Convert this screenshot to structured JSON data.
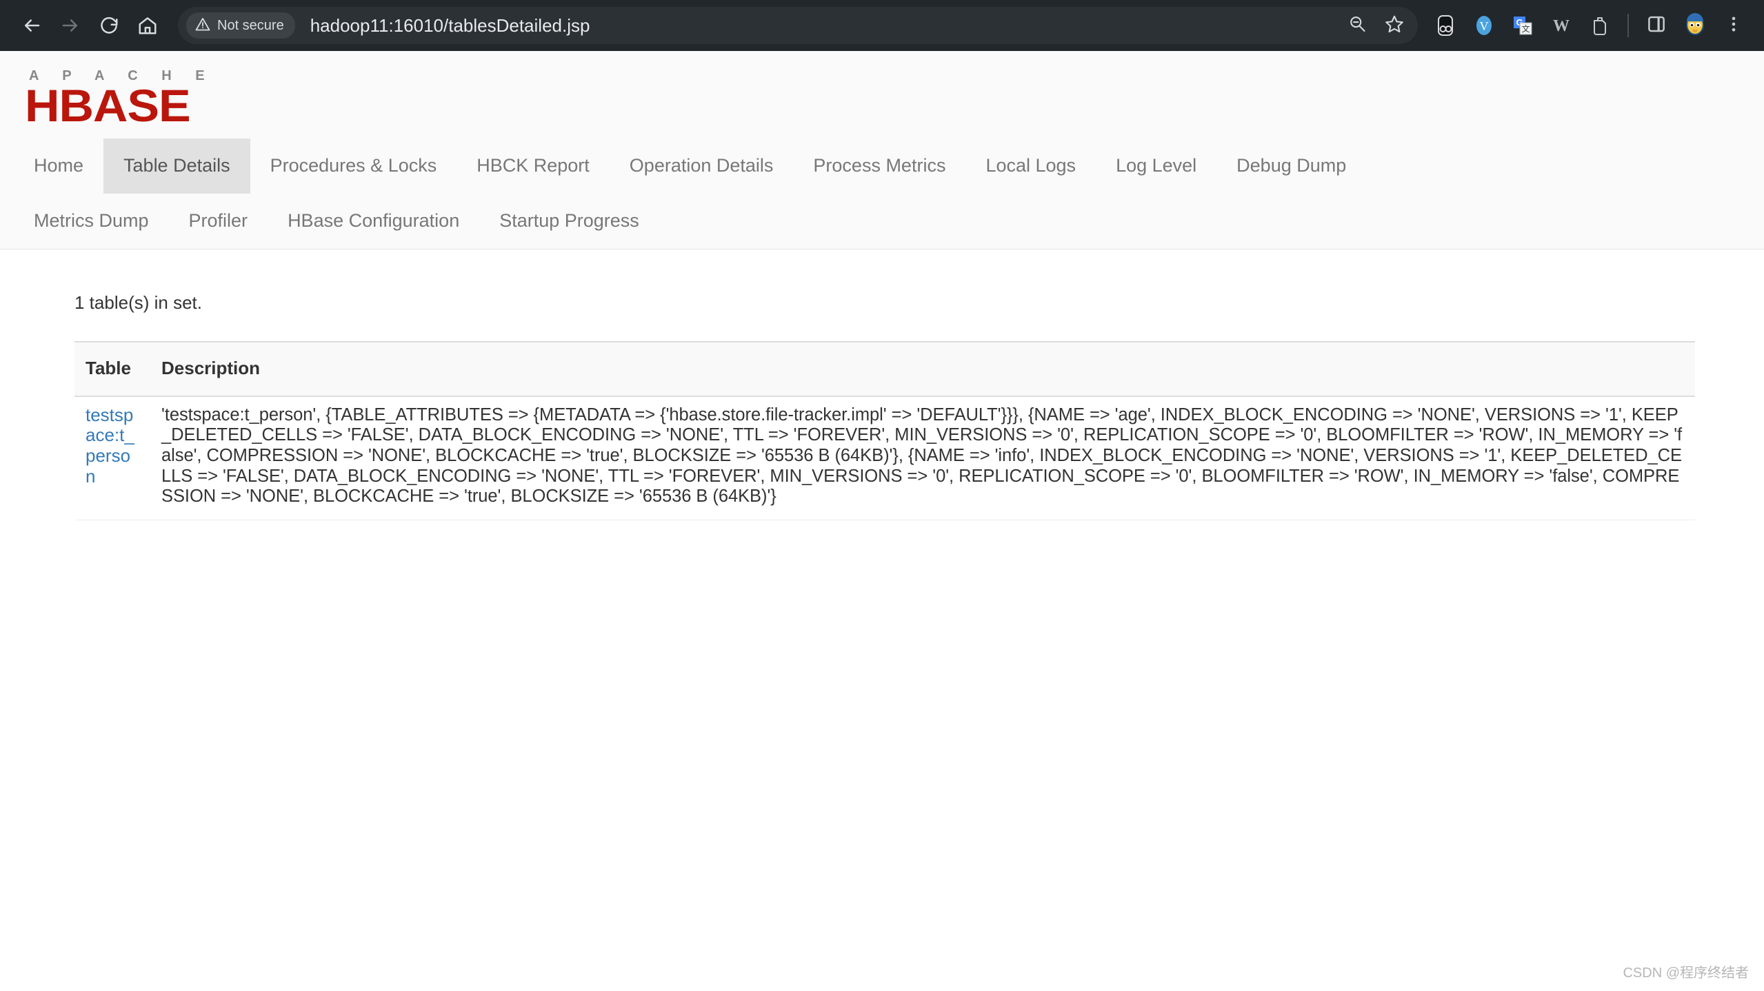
{
  "browser": {
    "back_icon": "back-arrow-icon",
    "forward_icon": "forward-arrow-icon",
    "reload_icon": "reload-icon",
    "home_icon": "home-icon",
    "security_label": "Not secure",
    "url": "hadoop11:16010/tablesDetailed.jsp",
    "zoom_out_icon": "zoom-out-icon",
    "bookmark_icon": "star-icon",
    "extensions": [
      {
        "name": "extension-icon-onetab"
      },
      {
        "name": "extension-icon-vimium"
      },
      {
        "name": "extension-icon-google-translate"
      },
      {
        "name": "extension-icon-w"
      },
      {
        "name": "extension-icon-clipboard"
      }
    ],
    "side_panel_icon": "side-panel-icon",
    "profile_icon": "profile-avatar-icon",
    "menu_icon": "three-dot-menu-icon"
  },
  "logo": {
    "apache": "A P A C H E",
    "hbase": "HBASE"
  },
  "nav": {
    "rows": [
      [
        {
          "label": "Home",
          "active": false
        },
        {
          "label": "Table Details",
          "active": true
        },
        {
          "label": "Procedures & Locks",
          "active": false
        },
        {
          "label": "HBCK Report",
          "active": false
        },
        {
          "label": "Operation Details",
          "active": false
        },
        {
          "label": "Process Metrics",
          "active": false
        },
        {
          "label": "Local Logs",
          "active": false
        },
        {
          "label": "Log Level",
          "active": false
        },
        {
          "label": "Debug Dump",
          "active": false
        }
      ],
      [
        {
          "label": "Metrics Dump",
          "active": false
        },
        {
          "label": "Profiler",
          "active": false
        },
        {
          "label": "HBase Configuration",
          "active": false
        },
        {
          "label": "Startup Progress",
          "active": false
        }
      ]
    ]
  },
  "content": {
    "table_count_text": "1 table(s) in set.",
    "columns": [
      "Table",
      "Description"
    ],
    "rows": [
      {
        "table": "testspace:t_person",
        "description": "'testspace:t_person', {TABLE_ATTRIBUTES => {METADATA => {'hbase.store.file-tracker.impl' => 'DEFAULT'}}}, {NAME => 'age', INDEX_BLOCK_ENCODING => 'NONE', VERSIONS => '1', KEEP_DELETED_CELLS => 'FALSE', DATA_BLOCK_ENCODING => 'NONE', TTL => 'FOREVER', MIN_VERSIONS => '0', REPLICATION_SCOPE => '0', BLOOMFILTER => 'ROW', IN_MEMORY => 'false', COMPRESSION => 'NONE', BLOCKCACHE => 'true', BLOCKSIZE => '65536 B (64KB)'}, {NAME => 'info', INDEX_BLOCK_ENCODING => 'NONE', VERSIONS => '1', KEEP_DELETED_CELLS => 'FALSE', DATA_BLOCK_ENCODING => 'NONE', TTL => 'FOREVER', MIN_VERSIONS => '0', REPLICATION_SCOPE => '0', BLOOMFILTER => 'ROW', IN_MEMORY => 'false', COMPRESSION => 'NONE', BLOCKCACHE => 'true', BLOCKSIZE => '65536 B (64KB)'}"
      }
    ]
  },
  "watermark": "CSDN @程序终结者",
  "colors": {
    "chrome_bg": "#21272b",
    "omnibox_bg": "#2b3135",
    "brand_red": "#ba160c",
    "link_blue": "#337ab7",
    "active_tab_bg": "#e1e1e1"
  }
}
